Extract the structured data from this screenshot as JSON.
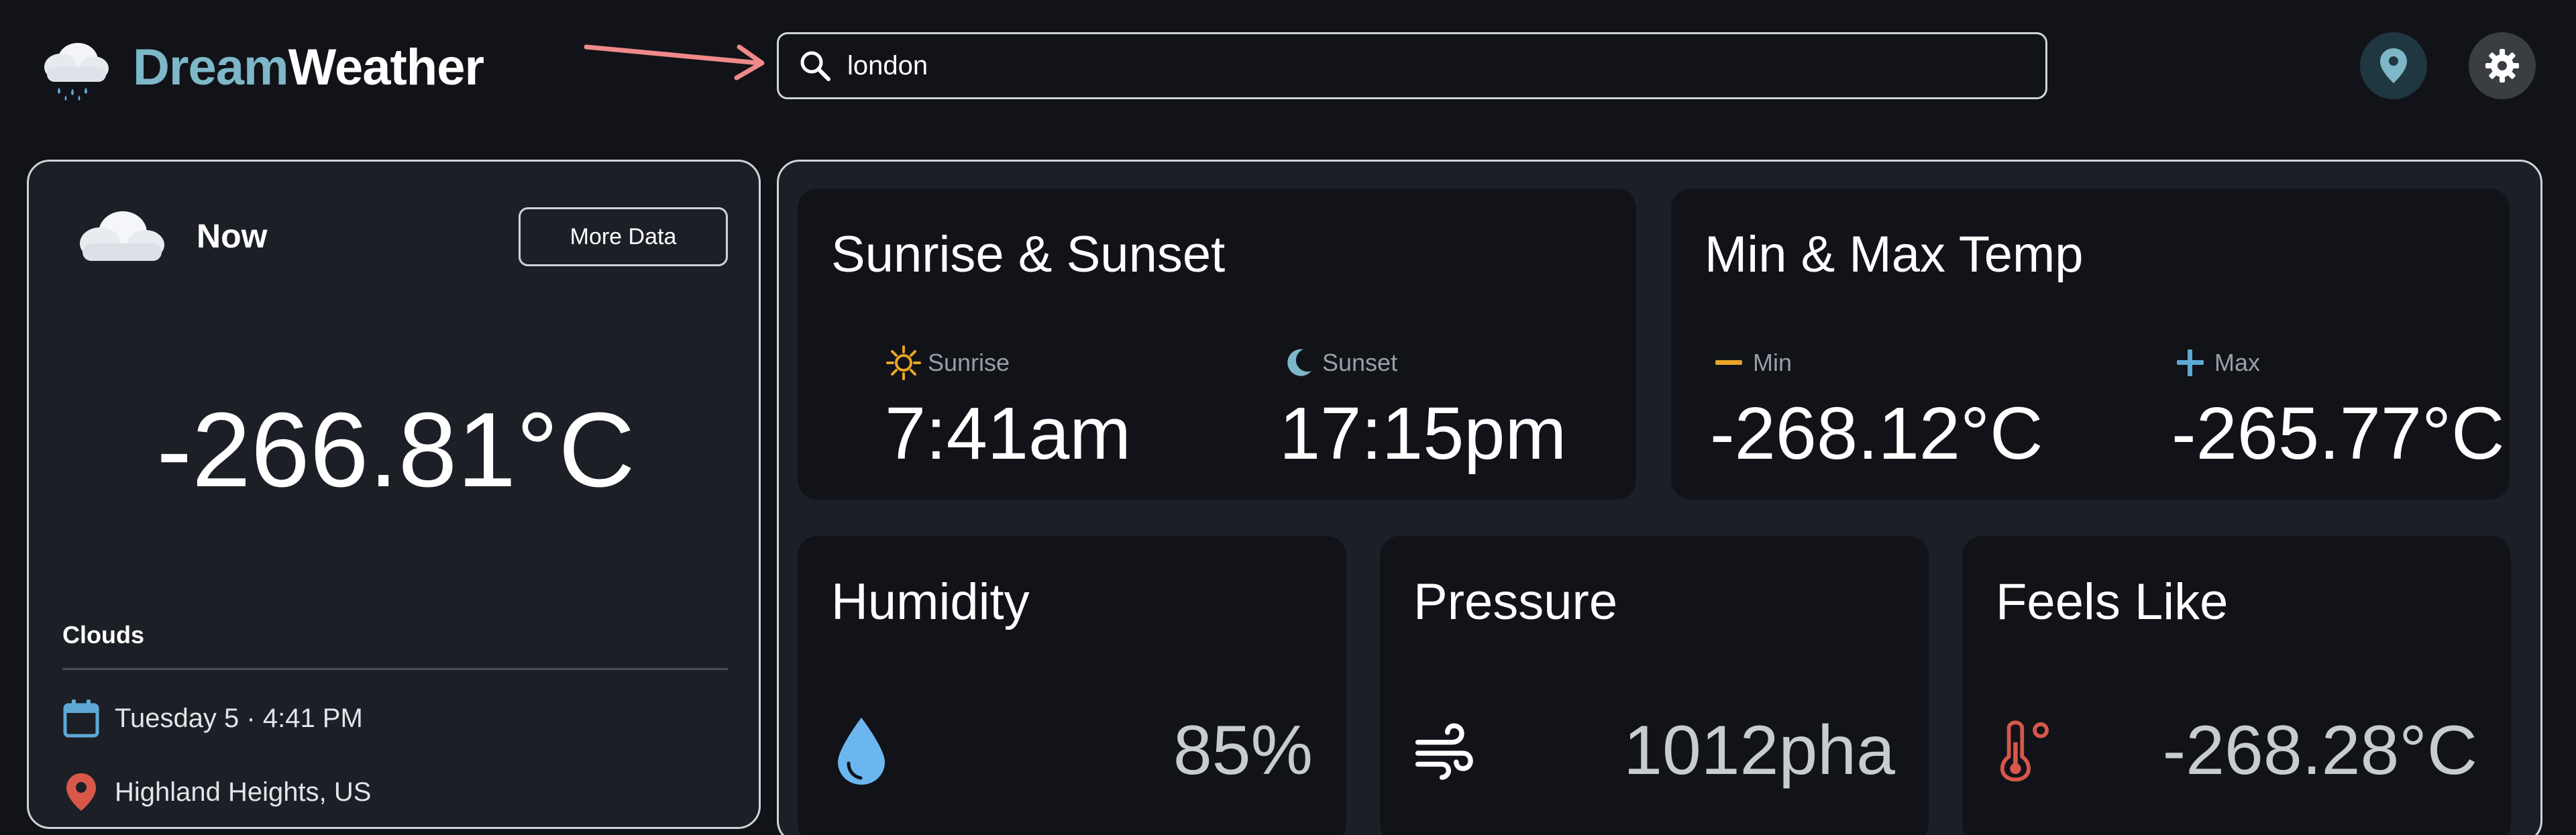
{
  "brand": {
    "part1": "Dream",
    "part2": "Weather"
  },
  "search": {
    "value": "london",
    "placeholder": ""
  },
  "header_icons": {
    "location": "location-pin-icon",
    "settings": "gear-icon"
  },
  "now": {
    "label": "Now",
    "more_button": "More Data",
    "temperature": "-266.81°C",
    "condition": "Clouds",
    "date": "Tuesday 5 · 4:41 PM",
    "location": "Highland Heights, US"
  },
  "highlights": {
    "sun": {
      "title": "Sunrise & Sunset",
      "sunrise_label": "Sunrise",
      "sunrise_value": "7:41am",
      "sunset_label": "Sunset",
      "sunset_value": "17:15pm"
    },
    "minmax": {
      "title": "Min & Max Temp",
      "min_label": "Min",
      "min_value": "-268.12°C",
      "max_label": "Max",
      "max_value": "-265.77°C"
    },
    "humidity": {
      "title": "Humidity",
      "value": "85%"
    },
    "pressure": {
      "title": "Pressure",
      "value": "1012pha"
    },
    "feels_like": {
      "title": "Feels Like",
      "value": "-268.28°C"
    }
  },
  "colors": {
    "background": "#111318",
    "panel": "#1c1f26",
    "brand_accent": "#7db7c8",
    "sun_icon": "#e9a52a",
    "moon_icon": "#7db7c8",
    "min_icon": "#e9a52a",
    "max_icon": "#5ea9d6",
    "humidity_icon": "#6cb6f0",
    "thermometer_icon": "#d9574a",
    "location_icon": "#d9574a",
    "annotation_arrow": "#f08a8a"
  }
}
